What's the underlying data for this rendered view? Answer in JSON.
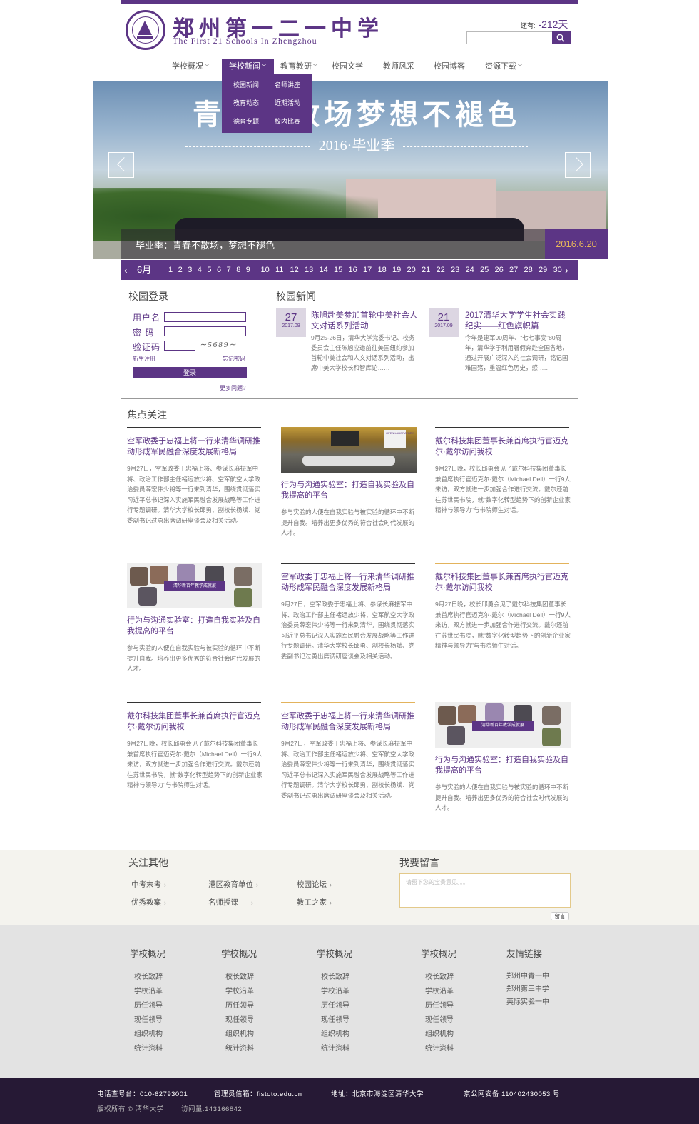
{
  "header": {
    "school_cn": "郑州第一二一中学",
    "school_en": "The First 21 Schools In Zhengzhou",
    "countdown_prefix": "还有:",
    "countdown_value": "-212天",
    "search_placeholder": "",
    "search_icon": "search-icon",
    "brand_color": "#5c3585"
  },
  "nav": {
    "items": [
      "学校概况",
      "学校新闻",
      "教育教研",
      "校园文学",
      "教师风采",
      "校园博客",
      "资源下载"
    ],
    "active": "学校新闻",
    "dropdown": [
      "校园新闻",
      "名师讲座",
      "教育动态",
      "近期活动",
      "德育专题",
      "校内比赛"
    ]
  },
  "banner": {
    "title": "青春不散场梦想不褪色",
    "subtitle": "2016·毕业季",
    "caption": "毕业季：青春不散场，梦想不褪色",
    "date": "2016.6.20"
  },
  "days": {
    "month": "6月",
    "list": [
      "1",
      "2",
      "3",
      "4",
      "5",
      "6",
      "7",
      "8",
      "9",
      "10",
      "11",
      "12",
      "13",
      "14",
      "15",
      "16",
      "17",
      "18",
      "19",
      "20",
      "21",
      "22",
      "23",
      "24",
      "25",
      "26",
      "27",
      "28",
      "29",
      "30"
    ]
  },
  "login": {
    "title": "校园登录",
    "username_label": "用户名",
    "password_label": "密 码",
    "captcha_label": "验证码",
    "captcha_value": "5689",
    "register": "新生注册",
    "forgot": "忘记密码",
    "submit": "登录",
    "more": "更多问题?"
  },
  "campus_news": {
    "title": "校园新闻",
    "items": [
      {
        "day": "27",
        "month": "2017.09",
        "title": "陈旭赴美参加首轮中美社会人文对话系列活动",
        "body": "9月25-26日，清华大学党委书记、校务委员会主任陈旭应邀前往美国纽约参加首轮中美社会和人文对话系列活动，出席中美大学校长和智库论……"
      },
      {
        "day": "21",
        "month": "2017.09",
        "title": "2017清华大学学生社会实践纪实——红色旗帜篇",
        "body": "今年是建军90周年、“七七事变”80周年，清华学子利用暑假奔赴全国各地，通过开展广泛深入的社会调研，铭记国难国殇，重温红色历史，感……"
      }
    ]
  },
  "focus": {
    "title": "焦点关注",
    "cards": [
      {
        "title": "空军政委于忠福上将一行来清华调研推动形成军民融合深度发展新格局",
        "body": "9月27日，空军政委于忠福上将、参谋长麻振军中将、政治工作部主任褚远放少将、空军航空大学政治委员薛宏伟少将等一行来到清华，围绕贯彻落实习近平总书记深入实施军民融合发展战略等工作进行专题调研。清华大学校长邱勇、副校长杨斌、党委副书记过勇出席调研座谈会及相关活动。"
      },
      {
        "title": "行为与沟通实验室：打造自我实验及自我提高的平台",
        "body": "参与实验的人便在自我实验与被实验的循环中不断提升自我。培养出更多优秀的符合社会时代发展的人才。"
      },
      {
        "title": "戴尔科技集团董事长兼首席执行官迈克尔·戴尔访问我校",
        "body": "9月27日晚，校长邱勇会见了戴尔科技集团董事长兼首席执行官迈克尔·戴尔（Michael Dell）一行9人来访，双方就进一步加强合作进行交流。戴尔还前往苏世民书院，就“数字化转型趋势下的创新企业家精神与领导力”与书院师生对话。"
      },
      {
        "title": "行为与沟通实验室：打造自我实验及自我提高的平台",
        "body": "参与实验的人便在自我实验与被实验的循环中不断提升自我。培养出更多优秀的符合社会时代发展的人才。"
      },
      {
        "title": "空军政委于忠福上将一行来清华调研推动形成军民融合深度发展新格局",
        "body": "9月27日，空军政委于忠福上将、参谋长麻振军中将、政治工作部主任褚远放少将、空军航空大学政治委员薛宏伟少将等一行来到清华，围绕贯彻落实习近平总书记深入实施军民融合发展战略等工作进行专题调研。清华大学校长邱勇、副校长杨斌、党委副书记过勇出席调研座谈会及相关活动。"
      },
      {
        "title": "戴尔科技集团董事长兼首席执行官迈克尔·戴尔访问我校",
        "body": "9月27日晚，校长邱勇会见了戴尔科技集团董事长兼首席执行官迈克尔·戴尔（Michael Dell）一行9人来访，双方就进一步加强合作进行交流。戴尔还前往苏世民书院，就“数字化转型趋势下的创新企业家精神与领导力”与书院师生对话。"
      },
      {
        "title": "戴尔科技集团董事长兼首席执行官迈克尔·戴尔访问我校",
        "body": "9月27日晚，校长邱勇会见了戴尔科技集团董事长兼首席执行官迈克尔·戴尔（Michael Dell）一行9人来访，双方就进一步加强合作进行交流。戴尔还前往苏世民书院，就“数字化转型趋势下的创新企业家精神与领导力”与书院师生对话。"
      },
      {
        "title": "空军政委于忠福上将一行来清华调研推动形成军民融合深度发展新格局",
        "body": "9月27日，空军政委于忠福上将、参谋长麻振军中将、政治工作部主任褚远放少将、空军航空大学政治委员薛宏伟少将等一行来到清华，围绕贯彻落实习近平总书记深入实施军民融合发展战略等工作进行专题调研。清华大学校长邱勇、副校长杨斌、党委副书记过勇出席调研座谈会及相关活动。"
      },
      {
        "title": "行为与沟通实验室：打造自我实验及自我提高的平台",
        "body": "参与实验的人便在自我实验与被实验的循环中不断提升自我。培养出更多优秀的符合社会时代发展的人才。"
      }
    ],
    "photo_banner": "清华新百年教学成就展",
    "photo_sign": "OPEN LABORATORY"
  },
  "follow": {
    "title": "关注其他",
    "links": [
      "中考末考",
      "港区教育单位",
      "校园论坛",
      "优秀教案",
      "名师授课",
      "教工之家"
    ],
    "chevron": "›"
  },
  "message": {
    "title": "我要留言",
    "placeholder": "请留下您的宝贵意见。。。",
    "submit": "留言"
  },
  "footer_nav": {
    "columns": [
      {
        "title": "学校概况",
        "items": [
          "校长致辞",
          "学校沿革",
          "历任领导",
          "现任领导",
          "组织机构",
          "统计资料"
        ]
      },
      {
        "title": "学校概况",
        "items": [
          "校长致辞",
          "学校沿革",
          "历任领导",
          "现任领导",
          "组织机构",
          "统计资料"
        ]
      },
      {
        "title": "学校概况",
        "items": [
          "校长致辞",
          "学校沿革",
          "历任领导",
          "现任领导",
          "组织机构",
          "统计资料"
        ]
      },
      {
        "title": "学校概况",
        "items": [
          "校长致辞",
          "学校沿革",
          "历任领导",
          "现任领导",
          "组织机构",
          "统计资料"
        ]
      },
      {
        "title": "友情链接",
        "items": [
          "郑州中青一中",
          "郑州第三中学",
          "英际实验一中"
        ]
      }
    ]
  },
  "bottom": {
    "phone": "电话查号台：010-62793001",
    "email": "管理员信箱：fistoto.edu.cn",
    "address": "地址：北京市海淀区清华大学",
    "icp": "京公网安备 110402430053 号",
    "copyright": "版权所有 © 清华大学",
    "visits": "访问量:143166842"
  }
}
